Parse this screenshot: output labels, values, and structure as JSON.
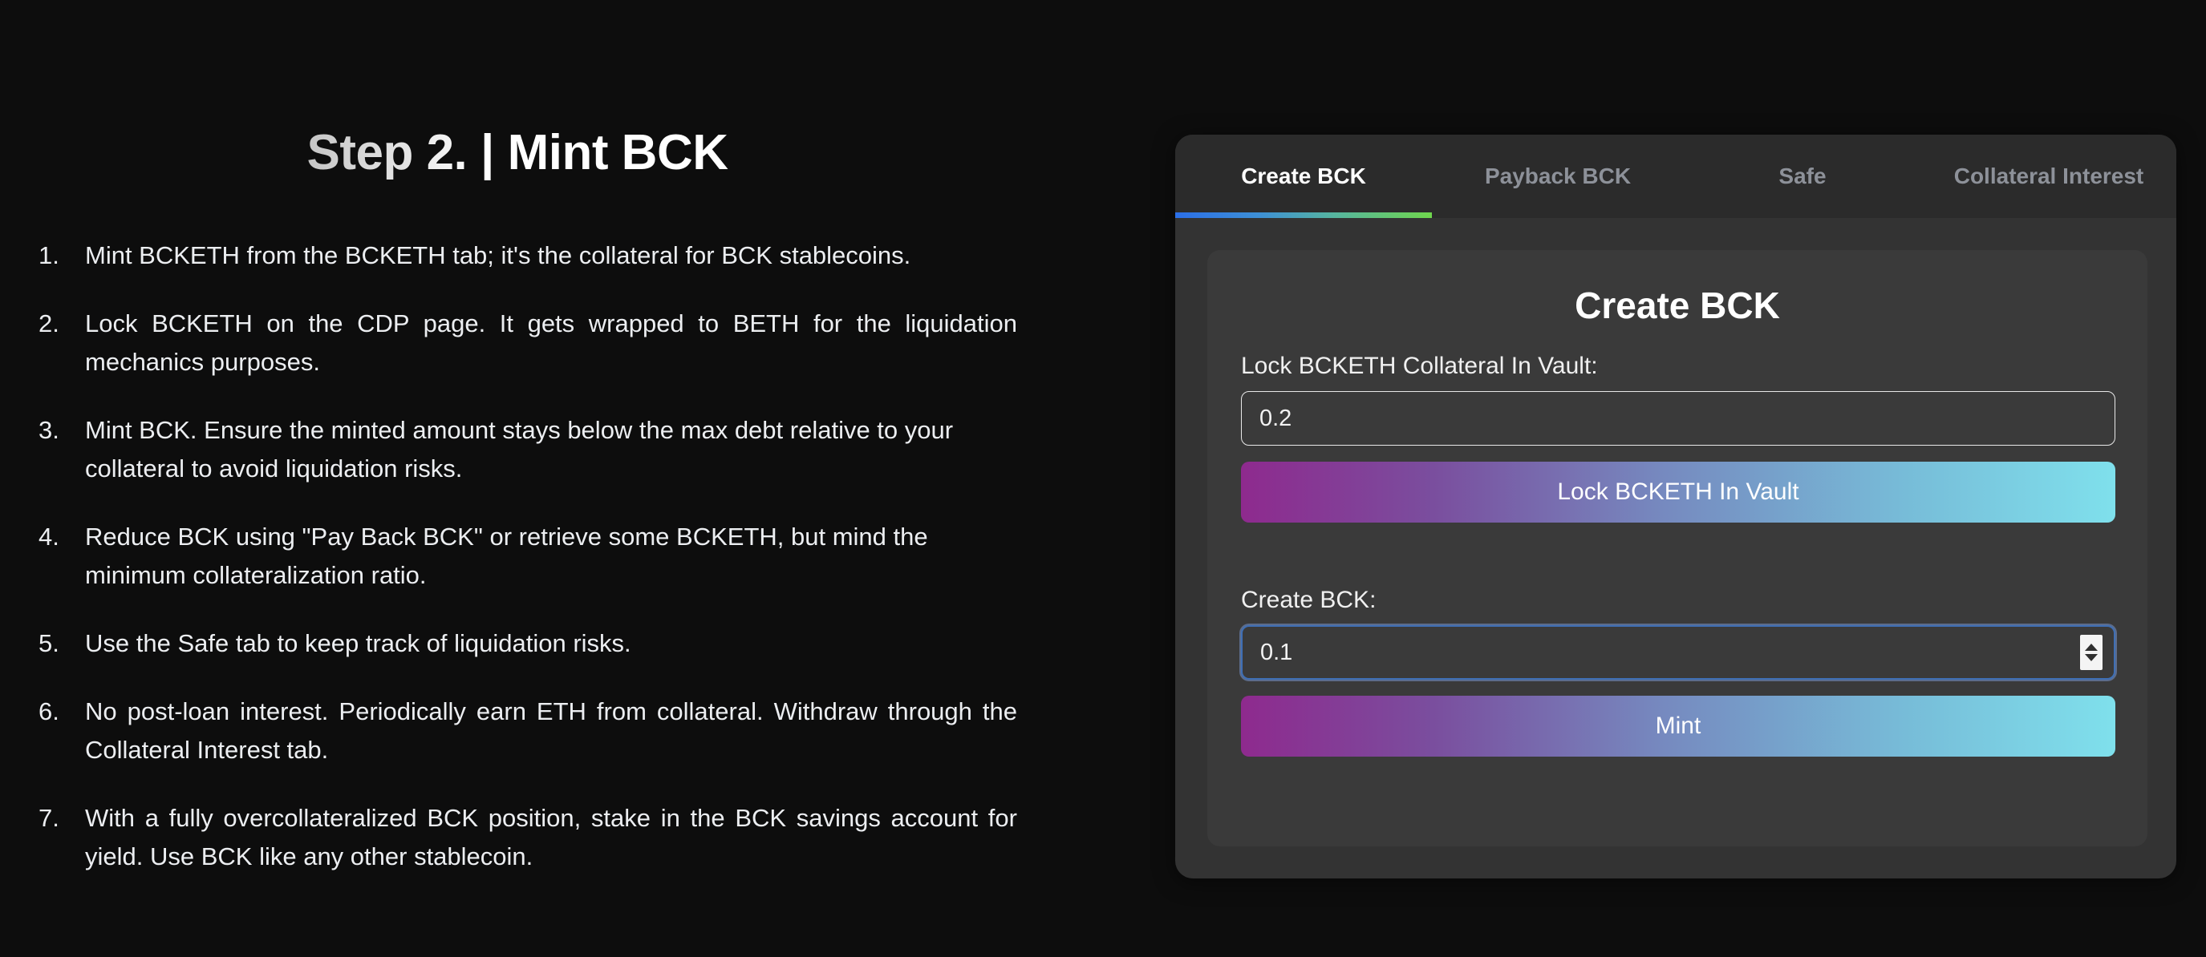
{
  "left": {
    "title_prefix": "Step 2. ",
    "title_suffix": "| Mint BCK",
    "title_full": "Step 2. | Mint BCK",
    "steps": [
      "Mint BCKETH from the BCKETH tab; it's the collateral for BCK stablecoins.",
      "Lock BCKETH on the CDP page. It gets wrapped to BETH for the liquidation mechanics purposes.",
      "Mint BCK. Ensure the minted amount stays below the max debt relative to your collateral to avoid liquidation risks.",
      "Reduce BCK using \"Pay Back BCK\" or retrieve some BCKETH, but mind the minimum collateralization ratio.",
      "Use the Safe tab to keep track of liquidation risks.",
      "No post-loan interest. Periodically earn ETH from collateral. Withdraw through the Collateral Interest tab.",
      "With a fully overcollateralized BCK position, stake in the BCK savings account for yield. Use BCK like any other stablecoin."
    ]
  },
  "panel": {
    "tabs": [
      {
        "label": "Create BCK",
        "active": true
      },
      {
        "label": "Payback BCK",
        "active": false
      },
      {
        "label": "Safe",
        "active": false
      },
      {
        "label": "Collateral Interest",
        "active": false
      }
    ],
    "card": {
      "title": "Create BCK",
      "lock_label": "Lock BCKETH Collateral In Vault:",
      "lock_value": "0.2",
      "lock_placeholder": "0.0",
      "lock_button": "Lock BCKETH In Vault",
      "create_label": "Create BCK:",
      "create_value": "0.1",
      "create_placeholder": "0.0",
      "mint_button": "Mint",
      "spinner_up_icon": "caret-up-icon",
      "spinner_down_icon": "caret-down-icon"
    }
  },
  "colors": {
    "background": "#0d0d0d",
    "panel_bg": "#333333",
    "tabbar_bg": "#2b2b2b",
    "card_bg": "#3a3a3a",
    "tab_active_text": "#ffffff",
    "tab_inactive_text": "#8d9199",
    "tab_underline_from": "#2b6fe8",
    "tab_underline_to": "#6fd64d",
    "button_gradient_from": "#8e2a8e",
    "button_gradient_to": "#7fe0ec",
    "focus_ring": "#3f6fb5",
    "body_text": "#eceef1"
  }
}
